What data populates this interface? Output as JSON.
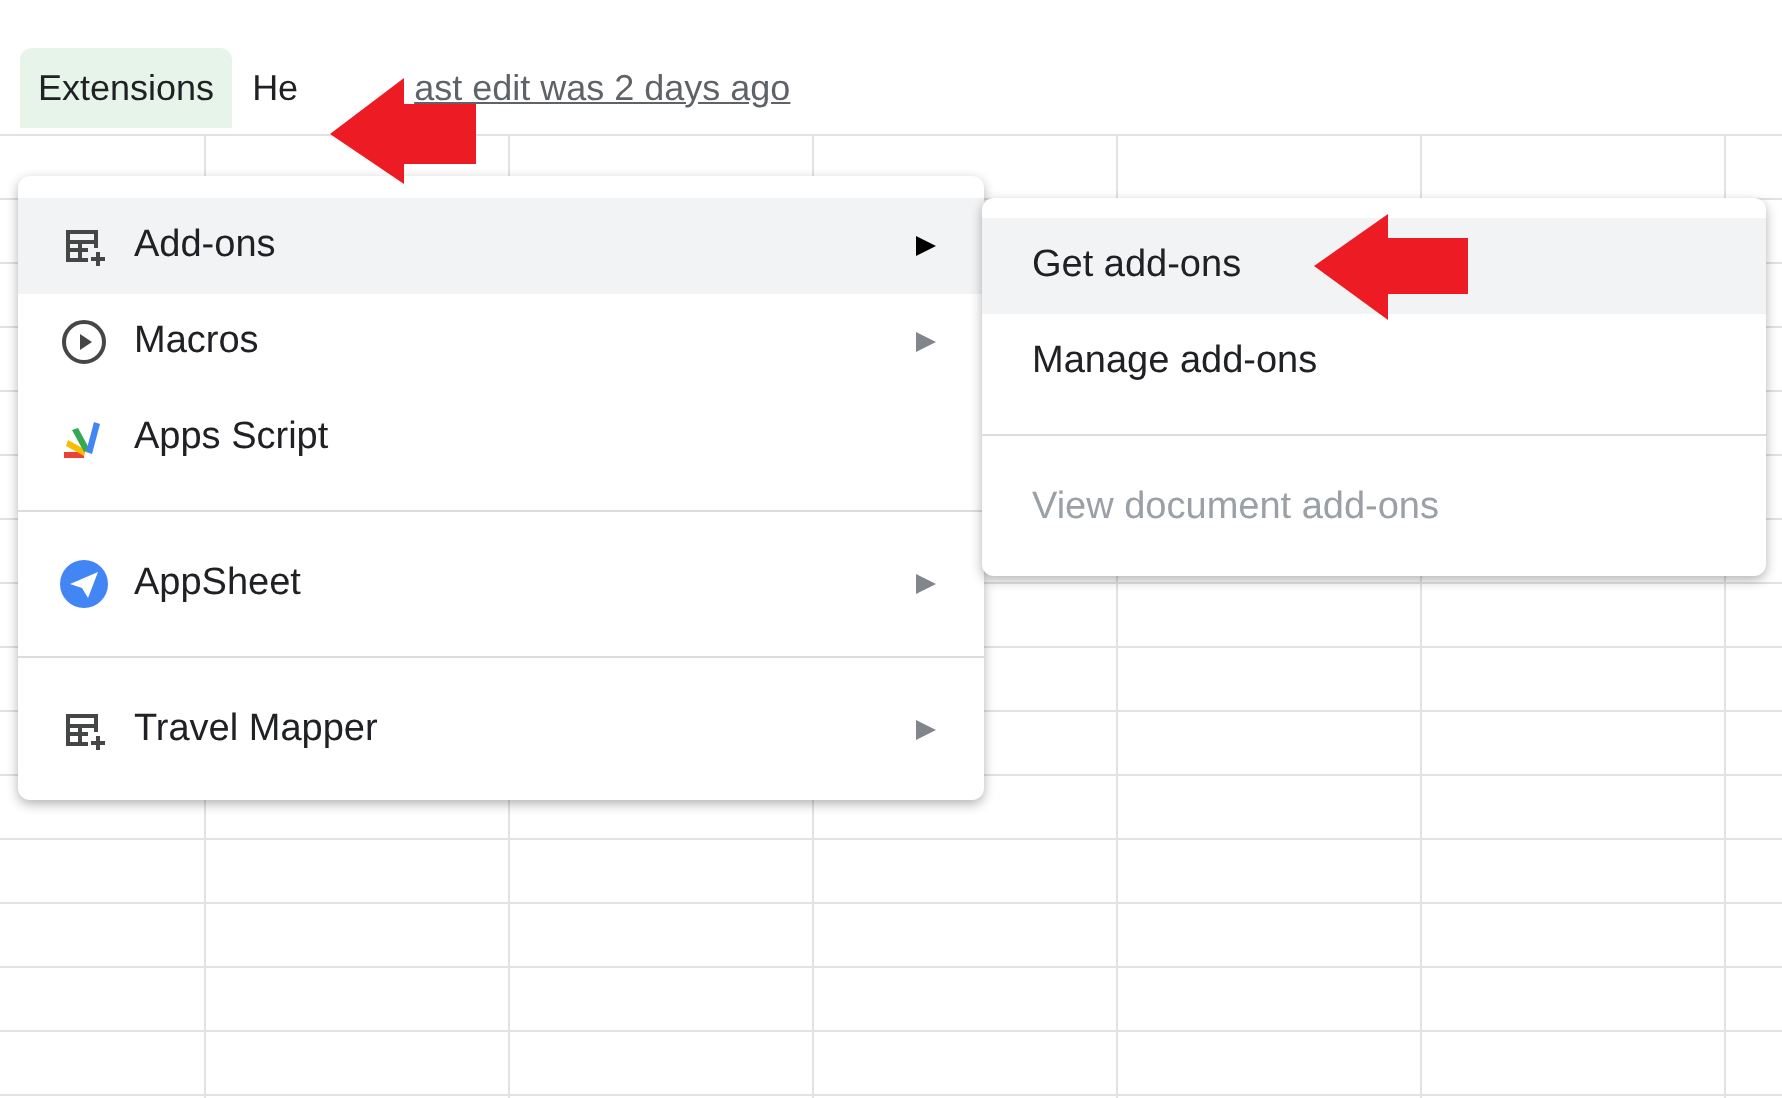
{
  "menubar": {
    "items": [
      {
        "label": "Extensions",
        "selected": true
      },
      {
        "label": "He",
        "selected": false
      }
    ],
    "last_edit": "ast edit was 2 days ago"
  },
  "menu": {
    "items": [
      {
        "kind": "item",
        "label": "Add-ons",
        "selected": true,
        "submenu": true
      },
      {
        "kind": "item",
        "label": "Macros",
        "selected": false,
        "submenu": true
      },
      {
        "kind": "item",
        "label": "Apps Script",
        "selected": false,
        "submenu": false
      },
      {
        "kind": "separator"
      },
      {
        "kind": "item",
        "label": "AppSheet",
        "selected": false,
        "submenu": true
      },
      {
        "kind": "separator"
      },
      {
        "kind": "item",
        "label": "Travel Mapper",
        "selected": false,
        "submenu": true
      }
    ]
  },
  "submenu": {
    "items": [
      {
        "kind": "item",
        "label": "Get add-ons",
        "selected": true,
        "disabled": false
      },
      {
        "kind": "item",
        "label": "Manage add-ons",
        "selected": false,
        "disabled": false
      },
      {
        "kind": "separator"
      },
      {
        "kind": "item",
        "label": "View document add-ons",
        "selected": false,
        "disabled": true
      }
    ]
  }
}
